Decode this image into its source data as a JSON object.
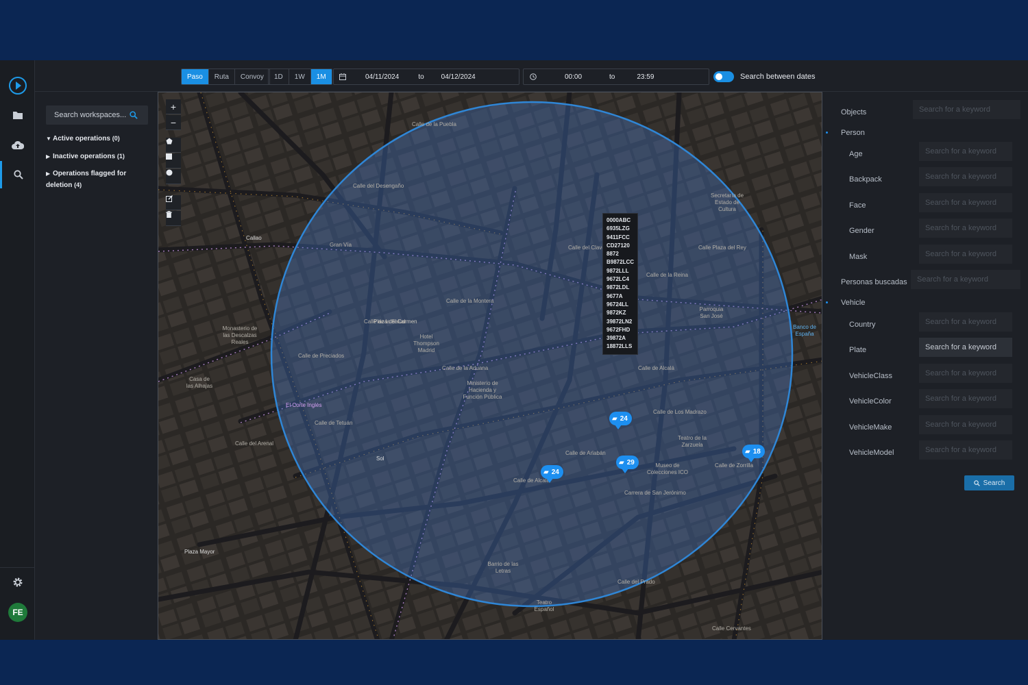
{
  "topbar": {
    "modes": [
      "Paso",
      "Ruta",
      "Convoy"
    ],
    "active_mode": "Paso",
    "ranges": [
      "1D",
      "1W",
      "1M"
    ],
    "active_range": "1M",
    "date_from": "04/11/2024",
    "date_sep": "to",
    "date_to": "04/12/2024",
    "time_from": "00:00",
    "time_sep": "to",
    "time_to": "23:59",
    "toggle_label": "Search between dates",
    "toggle_on": true
  },
  "sidebar": {
    "search_placeholder": "Search workspaces...",
    "items": [
      {
        "label": "Active operations",
        "count": "(0)",
        "expanded": true
      },
      {
        "label": "Inactive operations",
        "count": "(1)",
        "expanded": false
      },
      {
        "label": "Operations flagged for deletion",
        "count": "(4)",
        "expanded": false
      }
    ],
    "avatar_initials": "FE"
  },
  "map": {
    "streets": [
      "Gran Vía",
      "Calle de Alcalá",
      "Calle del Arenal",
      "Calle de la Montera",
      "Calle de Alcalá",
      "Calle de Preciados",
      "Calle de Zorrilla",
      "Carrera de San Jerónimo",
      "Calle del Prado",
      "Calle de la Aduana",
      "Calle del Desengaño",
      "Calle de la Reina",
      "Calle de Arlabán",
      "Calle de Los Madrazo",
      "Calle de Tetuán",
      "Calle del Clavel",
      "Calle de la Puebla",
      "Calle de la Salud",
      "Calle Plaza del Rey",
      "Calle Cervantes",
      "Callao",
      "Sol",
      "Plaza Mayor"
    ],
    "places": [
      "Plaza del Carmen",
      "Ministerio de Hacienda y Función Pública",
      "Hotel Thompson Madrid",
      "Monasterio de las Descalzas Reales",
      "El Corte Inglés",
      "Teatro de la Zarzuela",
      "Museo de Colecciones ICO",
      "Secretaría de Estado de Cultura",
      "Parroquia San José",
      "Banco de España",
      "Casa de las Alhajas",
      "Teatro Español",
      "Barrio de las Letras"
    ],
    "plates": [
      "0000ABC",
      "6935LZG",
      "9411FCC",
      "CD27120",
      "8872",
      "B9872LCC",
      "9872LLL",
      "9672LC4",
      "9872LDL",
      "9677A",
      "96724LL",
      "9872KZ",
      "39872LN2",
      "9672FHD",
      "39872A",
      "18872LLS"
    ],
    "clusters": [
      {
        "count": "24"
      },
      {
        "count": "24"
      },
      {
        "count": "29"
      },
      {
        "count": "18"
      }
    ],
    "controls": {
      "zoom_in": "+",
      "zoom_out": "−"
    }
  },
  "filters": {
    "placeholder": "Search for a keyword",
    "objects_label": "Objects",
    "person_label": "Person",
    "person_fields": [
      "Age",
      "Backpack",
      "Face",
      "Gender",
      "Mask"
    ],
    "personas_label": "Personas buscadas",
    "vehicle_label": "Vehicle",
    "vehicle_fields": [
      "Country",
      "Plate",
      "VehicleClass",
      "VehicleColor",
      "VehicleMake",
      "VehicleModel"
    ],
    "search_label": "Search"
  },
  "colors": {
    "accent": "#1a8fe3",
    "brand_bg": "#0b2653",
    "panel": "#1d2026"
  }
}
